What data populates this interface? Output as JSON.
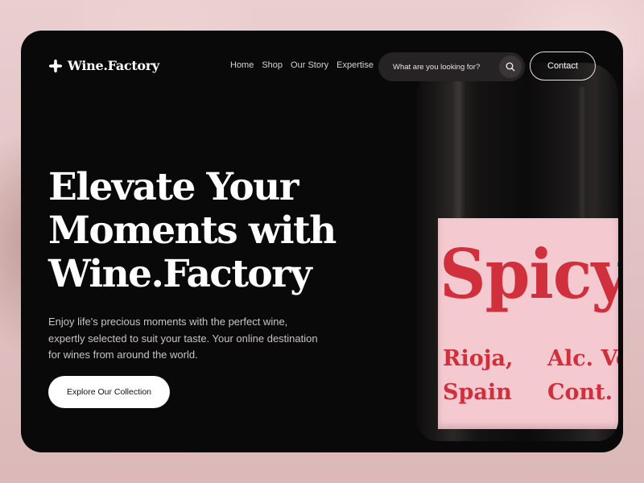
{
  "brand": {
    "name": "Wine.Factory",
    "icon": "sparkle-cross-icon"
  },
  "nav": {
    "items": [
      {
        "label": "Home"
      },
      {
        "label": "Shop"
      },
      {
        "label": "Our Story"
      },
      {
        "label": "Expertise"
      }
    ]
  },
  "search": {
    "placeholder": "What are you looking for?",
    "icon": "search-icon"
  },
  "contact": {
    "label": "Contact"
  },
  "hero": {
    "title_line1": "Elevate Your",
    "title_line2": "Moments with",
    "title_line3": "Wine.Factory",
    "description": "Enjoy life's precious moments with the perfect wine, expertly selected to suit your taste. Your online destination for wines from around the world.",
    "cta_label": "Explore Our Collection"
  },
  "bottle_label": {
    "brand": "Spicy",
    "origin_line1": "Rioja,",
    "origin_line2": "Spain",
    "alc_line1": "Alc. Vo",
    "alc_line2": "Cont. N"
  },
  "colors": {
    "card": "#0a0909",
    "label_pink": "#f4c9d0",
    "label_red": "#d0303c",
    "page_bg": "#e3c4c5"
  }
}
